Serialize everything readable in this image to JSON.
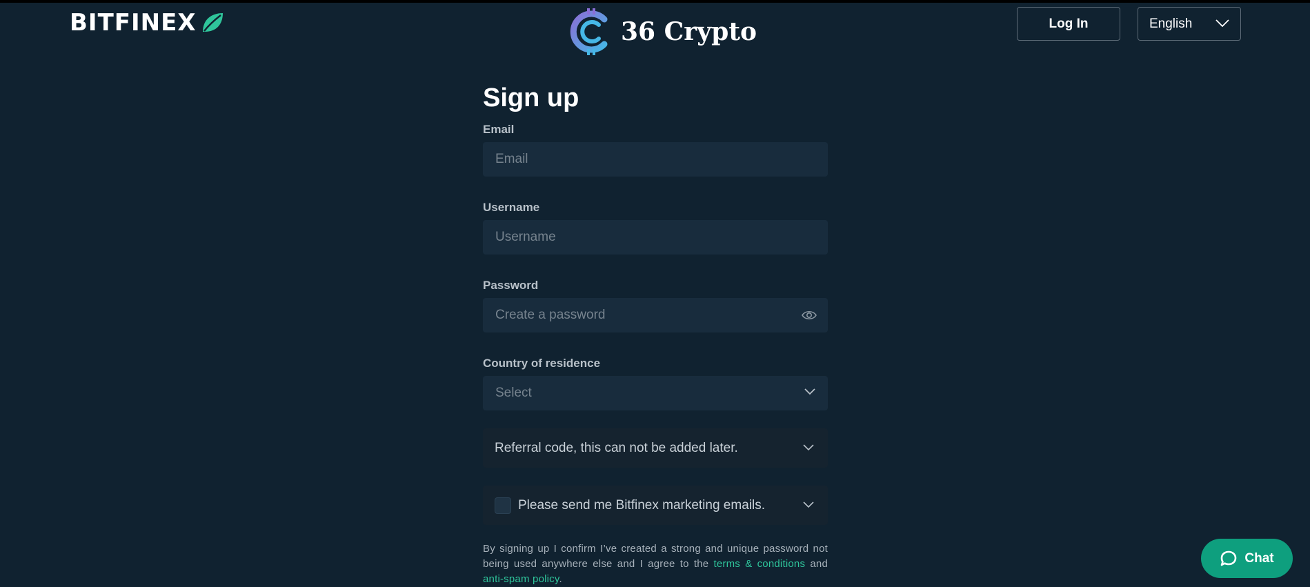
{
  "header": {
    "brand_name": "BITFINEX",
    "brand_leaf_color": "#2fc59b",
    "center_logo_text": "36 Crypto",
    "login_label": "Log In",
    "language_selected": "English"
  },
  "form": {
    "title": "Sign up",
    "email": {
      "label": "Email",
      "placeholder": "Email",
      "value": ""
    },
    "username": {
      "label": "Username",
      "placeholder": "Username",
      "value": ""
    },
    "password": {
      "label": "Password",
      "placeholder": "Create a password",
      "value": ""
    },
    "country": {
      "label": "Country of residence",
      "placeholder": "Select"
    },
    "referral_label": "Referral code, this can not be added later.",
    "marketing_label": "Please send me Bitfinex marketing emails.",
    "marketing_checked": false,
    "legal": {
      "prefix": "By signing up I confirm I’ve created a strong and unique password not being used anywhere else and I agree to the",
      "terms_link": "terms & conditions",
      "middle": "and",
      "spam_link": "anti-spam policy",
      "suffix": "."
    }
  },
  "chat": {
    "label": "Chat"
  },
  "colors": {
    "background": "#102230",
    "input_bg": "#182c3d",
    "accent": "#2fc59b",
    "chat_bg": "#0e9f7e"
  },
  "icons": {
    "brand": "leaf-icon",
    "center_logo": "crypto-coin-icon",
    "language": "chevron-down-icon",
    "password_visibility": "eye-icon",
    "select": "chevron-down-icon",
    "chat": "chat-bubble-icon"
  }
}
